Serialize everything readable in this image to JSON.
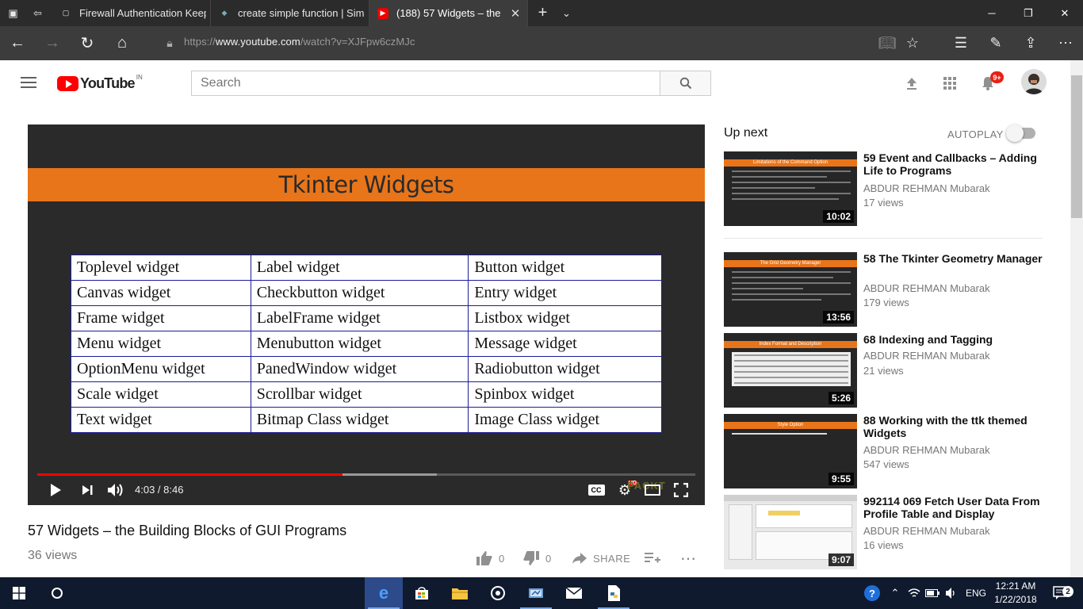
{
  "browser": {
    "tabs": [
      {
        "title": "Firewall Authentication Keep",
        "favicon": "page-icon"
      },
      {
        "title": "create simple function | Sim",
        "favicon": "site-icon"
      },
      {
        "title": "(188) 57 Widgets – the",
        "favicon": "youtube-icon",
        "active": true
      }
    ],
    "url_prefix": "https://",
    "url_host": "www.youtube.com",
    "url_path": "/watch?v=XJFpw6czMJc"
  },
  "youtube": {
    "logo_text": "YouTube",
    "country_code": "IN",
    "search_placeholder": "Search",
    "notification_count": "9+"
  },
  "player": {
    "slide_title": "Tkinter Widgets",
    "table": [
      [
        "Toplevel widget",
        "Label widget",
        "Button widget"
      ],
      [
        "Canvas widget",
        "Checkbutton widget",
        "Entry widget"
      ],
      [
        "Frame widget",
        "LabelFrame widget",
        "Listbox widget"
      ],
      [
        "Menu widget",
        "Menubutton widget",
        "Message widget"
      ],
      [
        "OptionMenu widget",
        "PanedWindow widget",
        "Radiobutton widget"
      ],
      [
        "Scale widget",
        "Scrollbar widget",
        "Spinbox widget"
      ],
      [
        "Text widget",
        "Bitmap Class widget",
        "Image Class widget"
      ]
    ],
    "time": "4:03 / 8:46",
    "played_fraction": 0.464,
    "buffered_fraction": 0.607,
    "watermark": "PACKT",
    "quality_badge": "HD",
    "cc_label": "CC"
  },
  "video": {
    "title": "57 Widgets – the Building Blocks of GUI Programs",
    "views": "36 views",
    "likes": "0",
    "dislikes": "0",
    "share_label": "SHARE"
  },
  "sidebar": {
    "upnext_label": "Up next",
    "autoplay_label": "AUTOPLAY",
    "autoplay_on": false,
    "videos": [
      {
        "title": "59 Event and Callbacks – Adding Life to Programs",
        "channel": "ABDUR REHMAN Mubarak",
        "views": "17 views",
        "duration": "10:02",
        "thumb_heading": "Limitations of the Command Option"
      },
      {
        "title": "58 The Tkinter Geometry Manager",
        "channel": "ABDUR REHMAN Mubarak",
        "views": "179 views",
        "duration": "13:56",
        "thumb_heading": "The Grid Geometry Manager"
      },
      {
        "title": "68 Indexing and Tagging",
        "channel": "ABDUR REHMAN Mubarak",
        "views": "21 views",
        "duration": "5:26",
        "thumb_heading": "Index Format and Description"
      },
      {
        "title": "88 Working with the ttk themed Widgets",
        "channel": "ABDUR REHMAN Mubarak",
        "views": "547 views",
        "duration": "9:55",
        "thumb_heading": "Style Option"
      },
      {
        "title": "992114 069 Fetch User Data From Profile Table and Display",
        "channel": "ABDUR REHMAN Mubarak",
        "views": "16 views",
        "duration": "9:07",
        "thumb_heading": ""
      }
    ]
  },
  "taskbar": {
    "language": "ENG",
    "time": "12:21 AM",
    "date": "1/22/2018",
    "notification_count": "2"
  },
  "colors": {
    "accent_red": "#ff0000",
    "slide_orange": "#e8751a",
    "taskbar_bg": "#101a2e",
    "browser_dark": "#2b2b2b"
  }
}
